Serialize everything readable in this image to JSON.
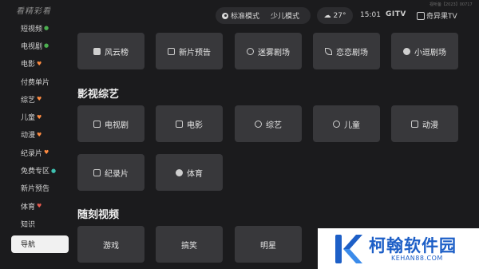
{
  "header": {
    "brand_script": "看精彩看",
    "mode_standard": "标准模式",
    "mode_kids": "少儿模式",
    "weather": "27°",
    "weather_icon": "cloud-icon",
    "time": "15:01",
    "logo_gitv": "GITV",
    "logo_qiyi": "奇异果TV",
    "tiny_note": "视听备【2023】00717"
  },
  "sidebar": {
    "items": [
      {
        "label": "短视频",
        "mark": "●",
        "mark_color": "green"
      },
      {
        "label": "电视剧",
        "mark": "●",
        "mark_color": "green"
      },
      {
        "label": "电影",
        "mark": "♥",
        "mark_color": "orange"
      },
      {
        "label": "付费单片",
        "mark": "",
        "mark_color": ""
      },
      {
        "label": "综艺",
        "mark": "♥",
        "mark_color": "orange"
      },
      {
        "label": "儿童",
        "mark": "♥",
        "mark_color": "orange"
      },
      {
        "label": "动漫",
        "mark": "♥",
        "mark_color": "orange"
      },
      {
        "label": "纪录片",
        "mark": "♥",
        "mark_color": "orange"
      },
      {
        "label": "免费专区",
        "mark": "●",
        "mark_color": "teal"
      },
      {
        "label": "新片预告",
        "mark": "",
        "mark_color": ""
      },
      {
        "label": "体育",
        "mark": "♥",
        "mark_color": "red"
      },
      {
        "label": "知识",
        "mark": "",
        "mark_color": ""
      }
    ],
    "active_label": "导航"
  },
  "row1": [
    {
      "label": "风云榜",
      "icon": "chart-icon"
    },
    {
      "label": "新片预告",
      "icon": "film-icon"
    },
    {
      "label": "迷雾剧场",
      "icon": "mist-icon"
    },
    {
      "label": "恋恋剧场",
      "icon": "leaf-icon"
    },
    {
      "label": "小逗剧场",
      "icon": "face-icon"
    }
  ],
  "section_ying": "影视综艺",
  "row2": [
    {
      "label": "电视剧",
      "icon": "tv-icon"
    },
    {
      "label": "电影",
      "icon": "movie-icon"
    },
    {
      "label": "综艺",
      "icon": "variety-icon"
    },
    {
      "label": "儿童",
      "icon": "kid-icon"
    },
    {
      "label": "动漫",
      "icon": "anime-icon"
    }
  ],
  "row3": [
    {
      "label": "纪录片",
      "icon": "documentary-icon"
    },
    {
      "label": "体育",
      "icon": "sports-icon"
    }
  ],
  "section_sui": "随刻视频",
  "row4": [
    {
      "label": "游戏"
    },
    {
      "label": "搞笑"
    },
    {
      "label": "明星"
    }
  ],
  "watermark": {
    "name": "柯翰软件园",
    "url": "KEHAN88.COM",
    "color": "#1d5fc7"
  }
}
